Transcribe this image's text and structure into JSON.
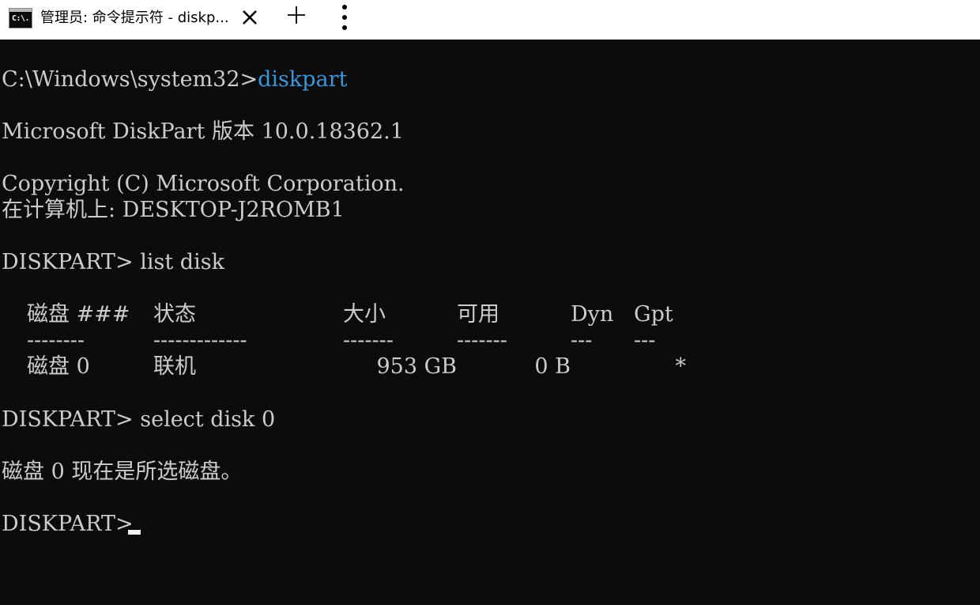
{
  "tab": {
    "title": "管理员: 命令提示符 - diskp...",
    "icon_text": "C:\\."
  },
  "prompt": {
    "path": "C:\\Windows\\system32>",
    "command": "diskpart"
  },
  "output": {
    "version": "Microsoft DiskPart 版本 10.0.18362.1",
    "copyright": "Copyright (C) Microsoft Corporation.",
    "computer": "在计算机上: DESKTOP-J2ROMB1",
    "list_cmd": "DISKPART> list disk",
    "select_cmd": "DISKPART> select disk 0",
    "select_result": "磁盘 0 现在是所选磁盘。",
    "final_prompt": "DISKPART> "
  },
  "disk_table": {
    "headers": {
      "disk": "磁盘 ###",
      "status": "状态",
      "size": "大小",
      "free": "可用",
      "dyn": "Dyn",
      "gpt": "Gpt"
    },
    "separators": {
      "disk": "--------",
      "status": "-------------",
      "size": "-------",
      "free": "-------",
      "dyn": "---",
      "gpt": "---"
    },
    "rows": [
      {
        "disk": "磁盘 0",
        "status": "联机",
        "size": "953 GB",
        "free": "0 B",
        "dyn": "",
        "gpt": "*"
      }
    ]
  },
  "colors": {
    "background": "#0c0c0c",
    "foreground": "#cccccc",
    "command": "#3a96dd",
    "tabbar": "#ffffff"
  },
  "icons": {
    "app": "cmd-app-icon",
    "close": "close-icon",
    "new_tab": "plus-icon",
    "menu": "more-vertical-icon"
  }
}
